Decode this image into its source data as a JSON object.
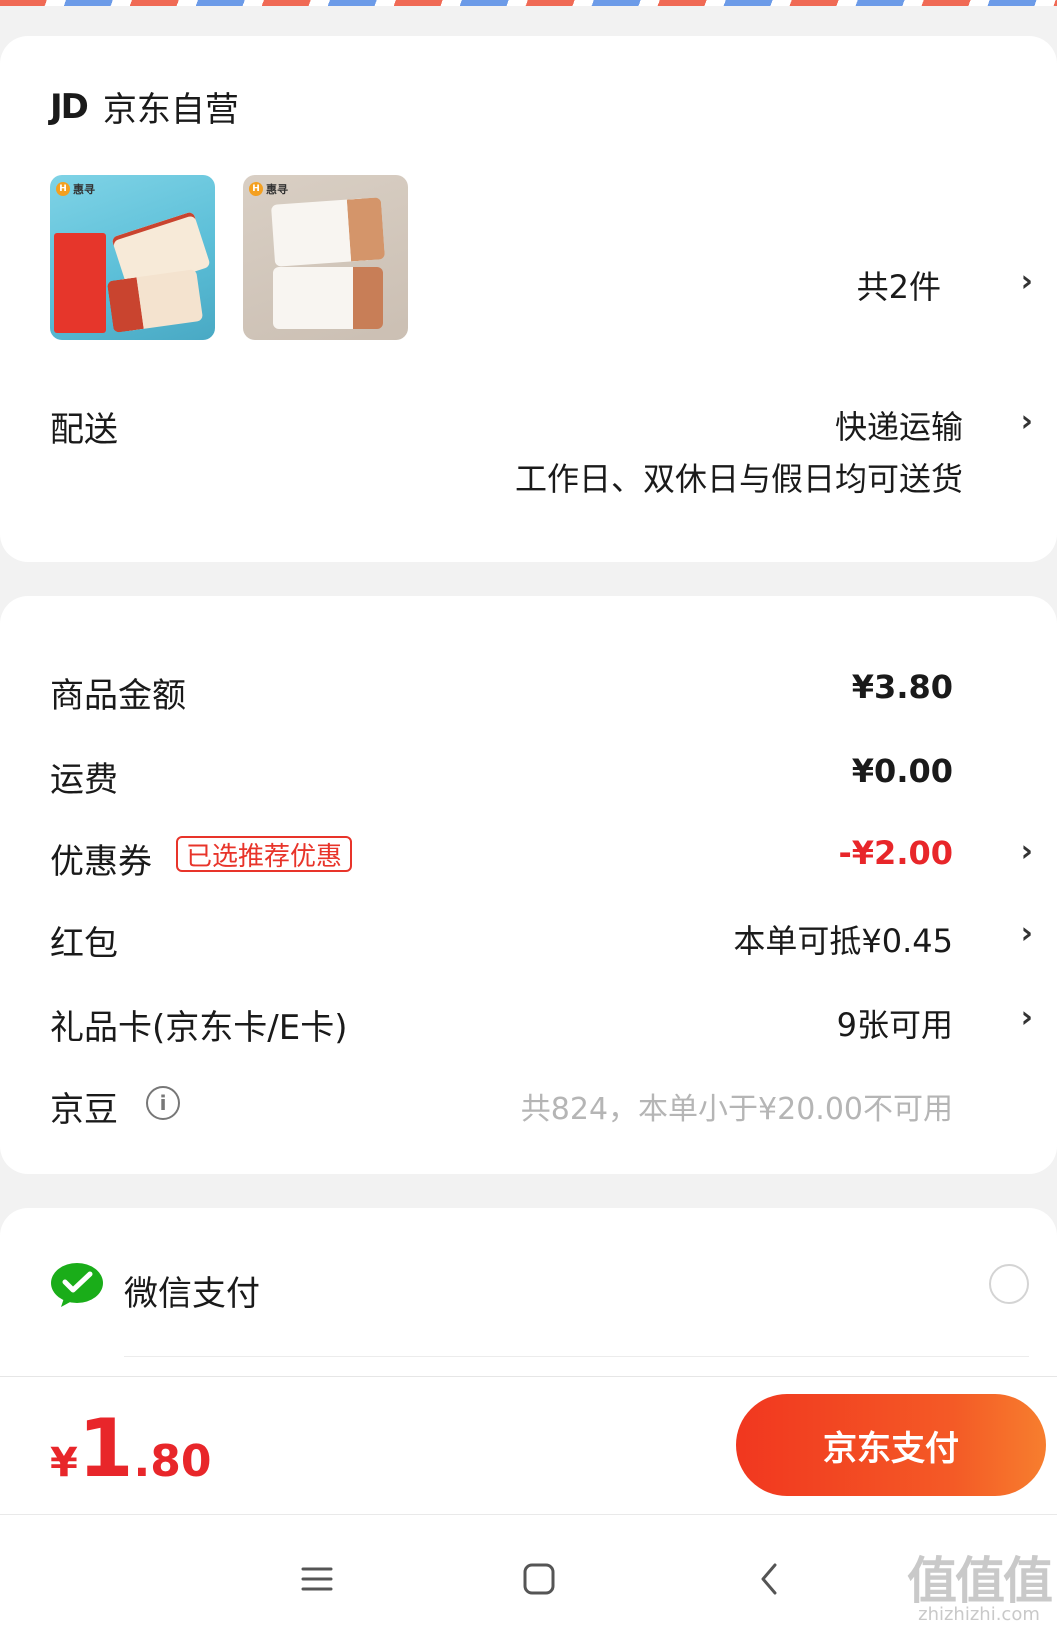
{
  "shop": {
    "logo_text": "JD",
    "name": "京东自营",
    "thumb1_brand": "惠寻",
    "thumb2_brand": "惠寻",
    "item_count": "共2件"
  },
  "delivery": {
    "label": "配送",
    "method": "快递运输",
    "note": "工作日、双休日与假日均可送货"
  },
  "price": {
    "goods_label": "商品金额",
    "goods_value": "¥3.80",
    "shipping_label": "运费",
    "shipping_value": "¥0.00",
    "coupon_label": "优惠券",
    "coupon_tag": "已选推荐优惠",
    "coupon_value": "-¥2.00",
    "redpacket_label": "红包",
    "redpacket_value": "本单可抵¥0.45",
    "giftcard_label": "礼品卡(京东卡/E卡)",
    "giftcard_value": "9张可用",
    "jingdou_label": "京豆",
    "jingdou_value": "共824，本单小于¥20.00不可用"
  },
  "payment": {
    "wechat_label": "微信支付",
    "wechat_icon": "wechat-pay-icon"
  },
  "bottom": {
    "total_currency": "¥",
    "total_int": "1",
    "total_dec": ".80",
    "pay_button": "京东支付"
  },
  "watermark": {
    "big": "值值值",
    "small": "zhizhizhi.com"
  },
  "colors": {
    "accent_red": "#e8262a",
    "pay_gradient_start": "#f1371f",
    "pay_gradient_end": "#f77e2e",
    "wechat_green": "#1aad19"
  }
}
